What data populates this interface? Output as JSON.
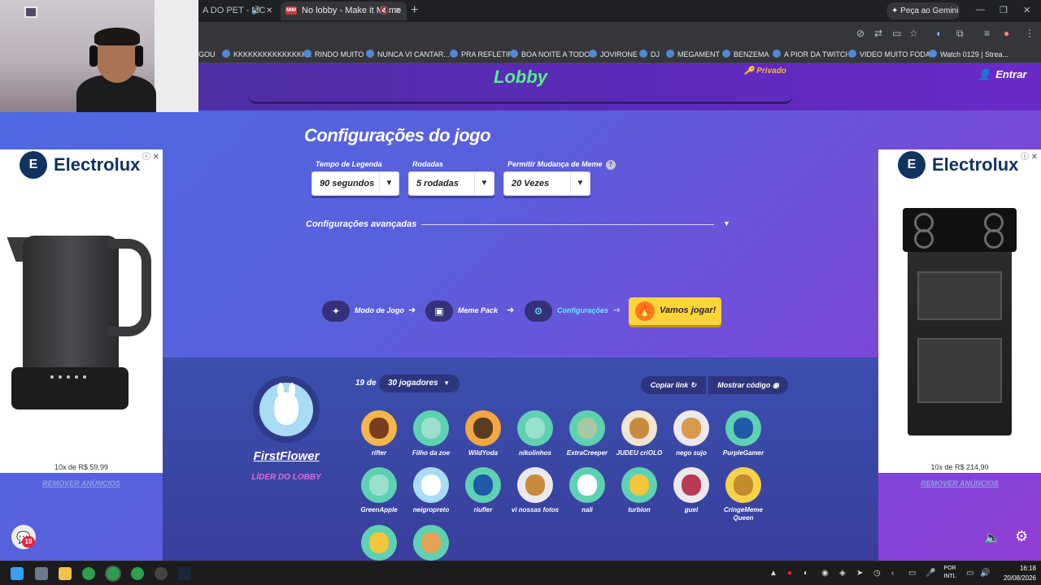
{
  "browser": {
    "tabs": [
      {
        "label": "A DO PET - MC",
        "active": false
      },
      {
        "label": "No lobby - Make it Meme",
        "active": true
      }
    ],
    "gemini_label": "Peça ao Gemini",
    "bookmarks": [
      "GOU",
      "KKKKKKKKKKKKKKKK",
      "RINDO MUITO",
      "NUNCA VI CANTAR...",
      "PRA REFLETIR",
      "BOA NOITE A TODO",
      "JOVIRONE",
      "DJ",
      "MEGAMENT",
      "BENZEMA",
      "A PIOR DA TWITCH",
      "VIDEO MUITO FODA",
      "Watch 0129 | Strea..."
    ]
  },
  "header": {
    "title": "Lobby",
    "privacy": "Privado",
    "login": "Entrar"
  },
  "settings": {
    "title": "Configurações do jogo",
    "time_label": "Tempo de Legenda",
    "time_value": "90 segundos",
    "rounds_label": "Rodadas",
    "rounds_value": "5 rodadas",
    "meme_change_label": "Permitir Mudança de Meme",
    "meme_change_help": "?",
    "meme_change_value": "20 Vezes",
    "advanced_label": "Configurações avançadas"
  },
  "steps": [
    {
      "label": "Modo de Jogo",
      "icon": "sparkle-icon",
      "glyph": "✦"
    },
    {
      "label": "Meme Pack",
      "icon": "pack-icon",
      "glyph": "▣"
    },
    {
      "label": "Configurações",
      "icon": "gear-icon",
      "glyph": "⚙"
    }
  ],
  "play_button": "Vamos jogar!",
  "lobby": {
    "leader_name": "FirstFlower",
    "leader_role": "LÍDER DO LOBBY",
    "player_count": "19 de",
    "max_players": "30 jogadores",
    "copy_link": "Copiar link",
    "show_code": "Mostrar código",
    "players": [
      {
        "name": "rifter",
        "color": "#f5b64a",
        "face": "#7a3b1e"
      },
      {
        "name": "Filho da zoe",
        "color": "#5fd1b3",
        "face": "#9be0cf"
      },
      {
        "name": "WildYoda",
        "color": "#f3a642",
        "face": "#5a3c22"
      },
      {
        "name": "nikolinhos",
        "color": "#5fd1b3",
        "face": "#9be0cf"
      },
      {
        "name": "ExtraCreeper",
        "color": "#5fd1b3",
        "face": "#a7c8a2"
      },
      {
        "name": "JUDEU criOLO",
        "color": "#f0e4d2",
        "face": "#c98a3e"
      },
      {
        "name": "nego sujo",
        "color": "#ece9ee",
        "face": "#d59b4b"
      },
      {
        "name": "PurpleGamer",
        "color": "#5fd1b3",
        "face": "#1f5aa8"
      },
      {
        "name": "GreenApple",
        "color": "#5fd1b3",
        "face": "#9be0cf"
      },
      {
        "name": "neigropreto",
        "color": "#a9dcf4",
        "face": "#ffffff"
      },
      {
        "name": "riufler",
        "color": "#5fd1b3",
        "face": "#1f5aa8"
      },
      {
        "name": "vi nossas fotos",
        "color": "#ece9ee",
        "face": "#c98a3e"
      },
      {
        "name": "nali",
        "color": "#5fd1b3",
        "face": "#ffffff"
      },
      {
        "name": "turbion",
        "color": "#5fd1b3",
        "face": "#f2c53a"
      },
      {
        "name": "guel",
        "color": "#ece9ee",
        "face": "#b83a54"
      },
      {
        "name": "CringeMeme Queen",
        "color": "#f5d24a",
        "face": "#c48a2c"
      },
      {
        "name": "",
        "color": "#5fd1b3",
        "face": "#f2c53a"
      },
      {
        "name": "",
        "color": "#5fd1b3",
        "face": "#e3a355"
      }
    ]
  },
  "ads": {
    "brand": "Electrolux",
    "left_price": "10x de R$ 59,99",
    "right_price": "10x de R$ 214,90",
    "remove": "REMOVER ANÚNCIOS"
  },
  "chat_badge": "19",
  "taskbar": {
    "lang": "POR\nINTL",
    "time": "16:18",
    "date": "20/08/2026"
  }
}
